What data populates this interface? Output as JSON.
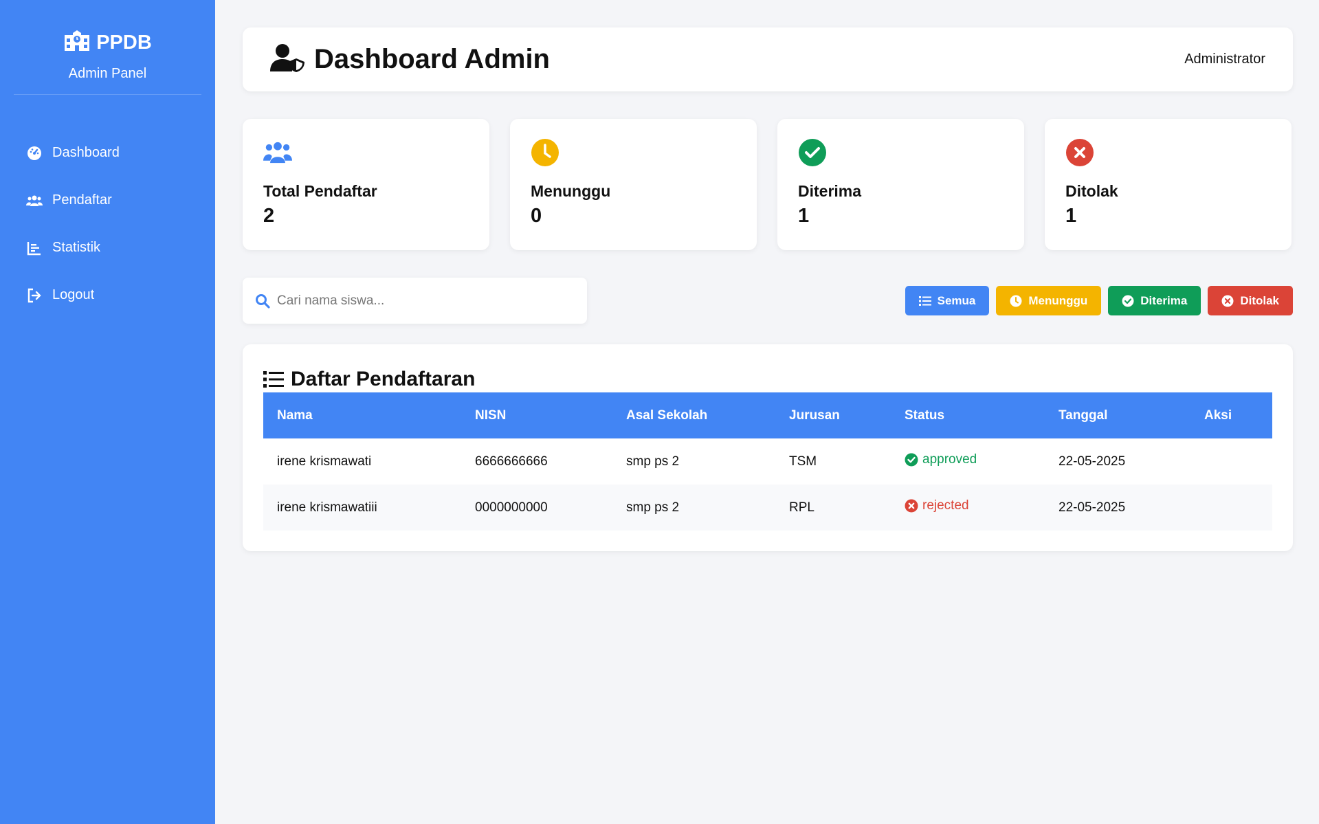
{
  "sidebar": {
    "brand": "PPDB",
    "subtitle": "Admin Panel",
    "items": [
      {
        "label": "Dashboard",
        "icon": "gauge-icon"
      },
      {
        "label": "Pendaftar",
        "icon": "users-icon"
      },
      {
        "label": "Statistik",
        "icon": "chart-icon"
      },
      {
        "label": "Logout",
        "icon": "logout-icon"
      }
    ]
  },
  "header": {
    "title": "Dashboard Admin",
    "user": "Administrator"
  },
  "cards": [
    {
      "label": "Total Pendaftar",
      "value": "2",
      "color": "#4285f4"
    },
    {
      "label": "Menunggu",
      "value": "0",
      "color": "#f4b400"
    },
    {
      "label": "Diterima",
      "value": "1",
      "color": "#0f9d58"
    },
    {
      "label": "Ditolak",
      "value": "1",
      "color": "#db4437"
    }
  ],
  "search": {
    "placeholder": "Cari nama siswa..."
  },
  "filters": [
    {
      "label": "Semua",
      "color": "#4285f4"
    },
    {
      "label": "Menunggu",
      "color": "#f4b400"
    },
    {
      "label": "Diterima",
      "color": "#0f9d58"
    },
    {
      "label": "Ditolak",
      "color": "#db4437"
    }
  ],
  "table": {
    "title": "Daftar Pendaftaran",
    "columns": [
      "Nama",
      "NISN",
      "Asal Sekolah",
      "Jurusan",
      "Status",
      "Tanggal",
      "Aksi"
    ],
    "rows": [
      {
        "nama": "irene krismawati",
        "nisn": "6666666666",
        "asal": "smp ps 2",
        "jurusan": "TSM",
        "status": "approved",
        "status_color": "#0f9d58",
        "tanggal": "22-05-2025",
        "aksi": ""
      },
      {
        "nama": "irene krismawatiii",
        "nisn": "0000000000",
        "asal": "smp ps 2",
        "jurusan": "RPL",
        "status": "rejected",
        "status_color": "#db4437",
        "tanggal": "22-05-2025",
        "aksi": ""
      }
    ]
  }
}
